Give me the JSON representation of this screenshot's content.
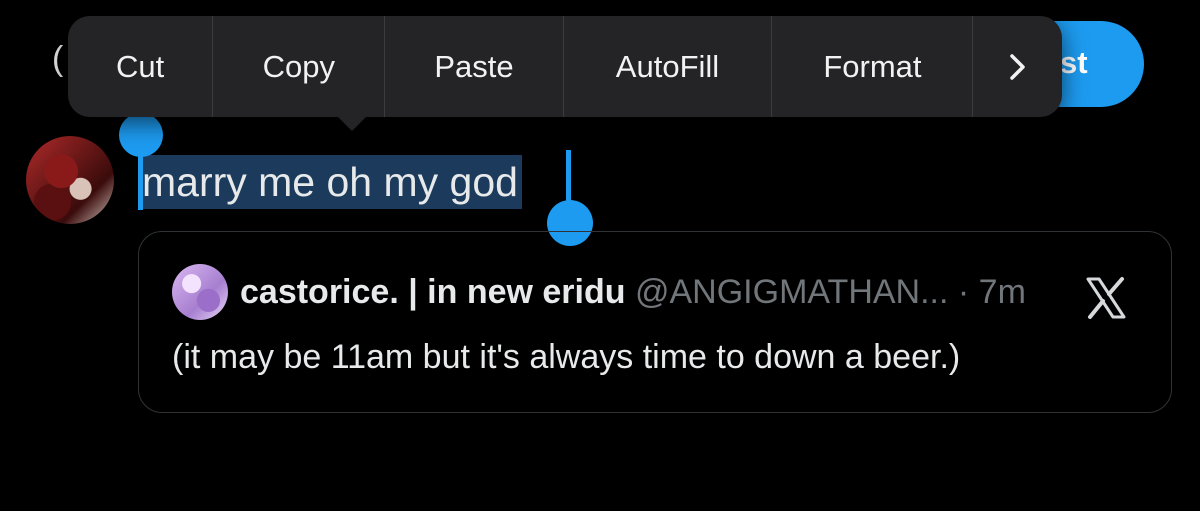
{
  "top_bar": {
    "cancel_peek": "(",
    "post_label": "st"
  },
  "edit_menu": {
    "items": [
      "Cut",
      "Copy",
      "Paste",
      "AutoFill",
      "Format"
    ],
    "more_icon": "chevron-right-icon"
  },
  "compose": {
    "selected_text": "marry me oh my god"
  },
  "quote": {
    "name": "castorice. | in new eridu",
    "handle": "@ANGIGMATHAN...",
    "time": "· 7m",
    "body": "(it may be 11am but it's always time to down a beer.)",
    "remove_icon": "x-logo-icon"
  },
  "colors": {
    "accent": "#1d9bf0",
    "background": "#000000",
    "menu_bg": "#242426",
    "selection_bg": "#1b3a5c",
    "secondary_text": "#71767b"
  }
}
